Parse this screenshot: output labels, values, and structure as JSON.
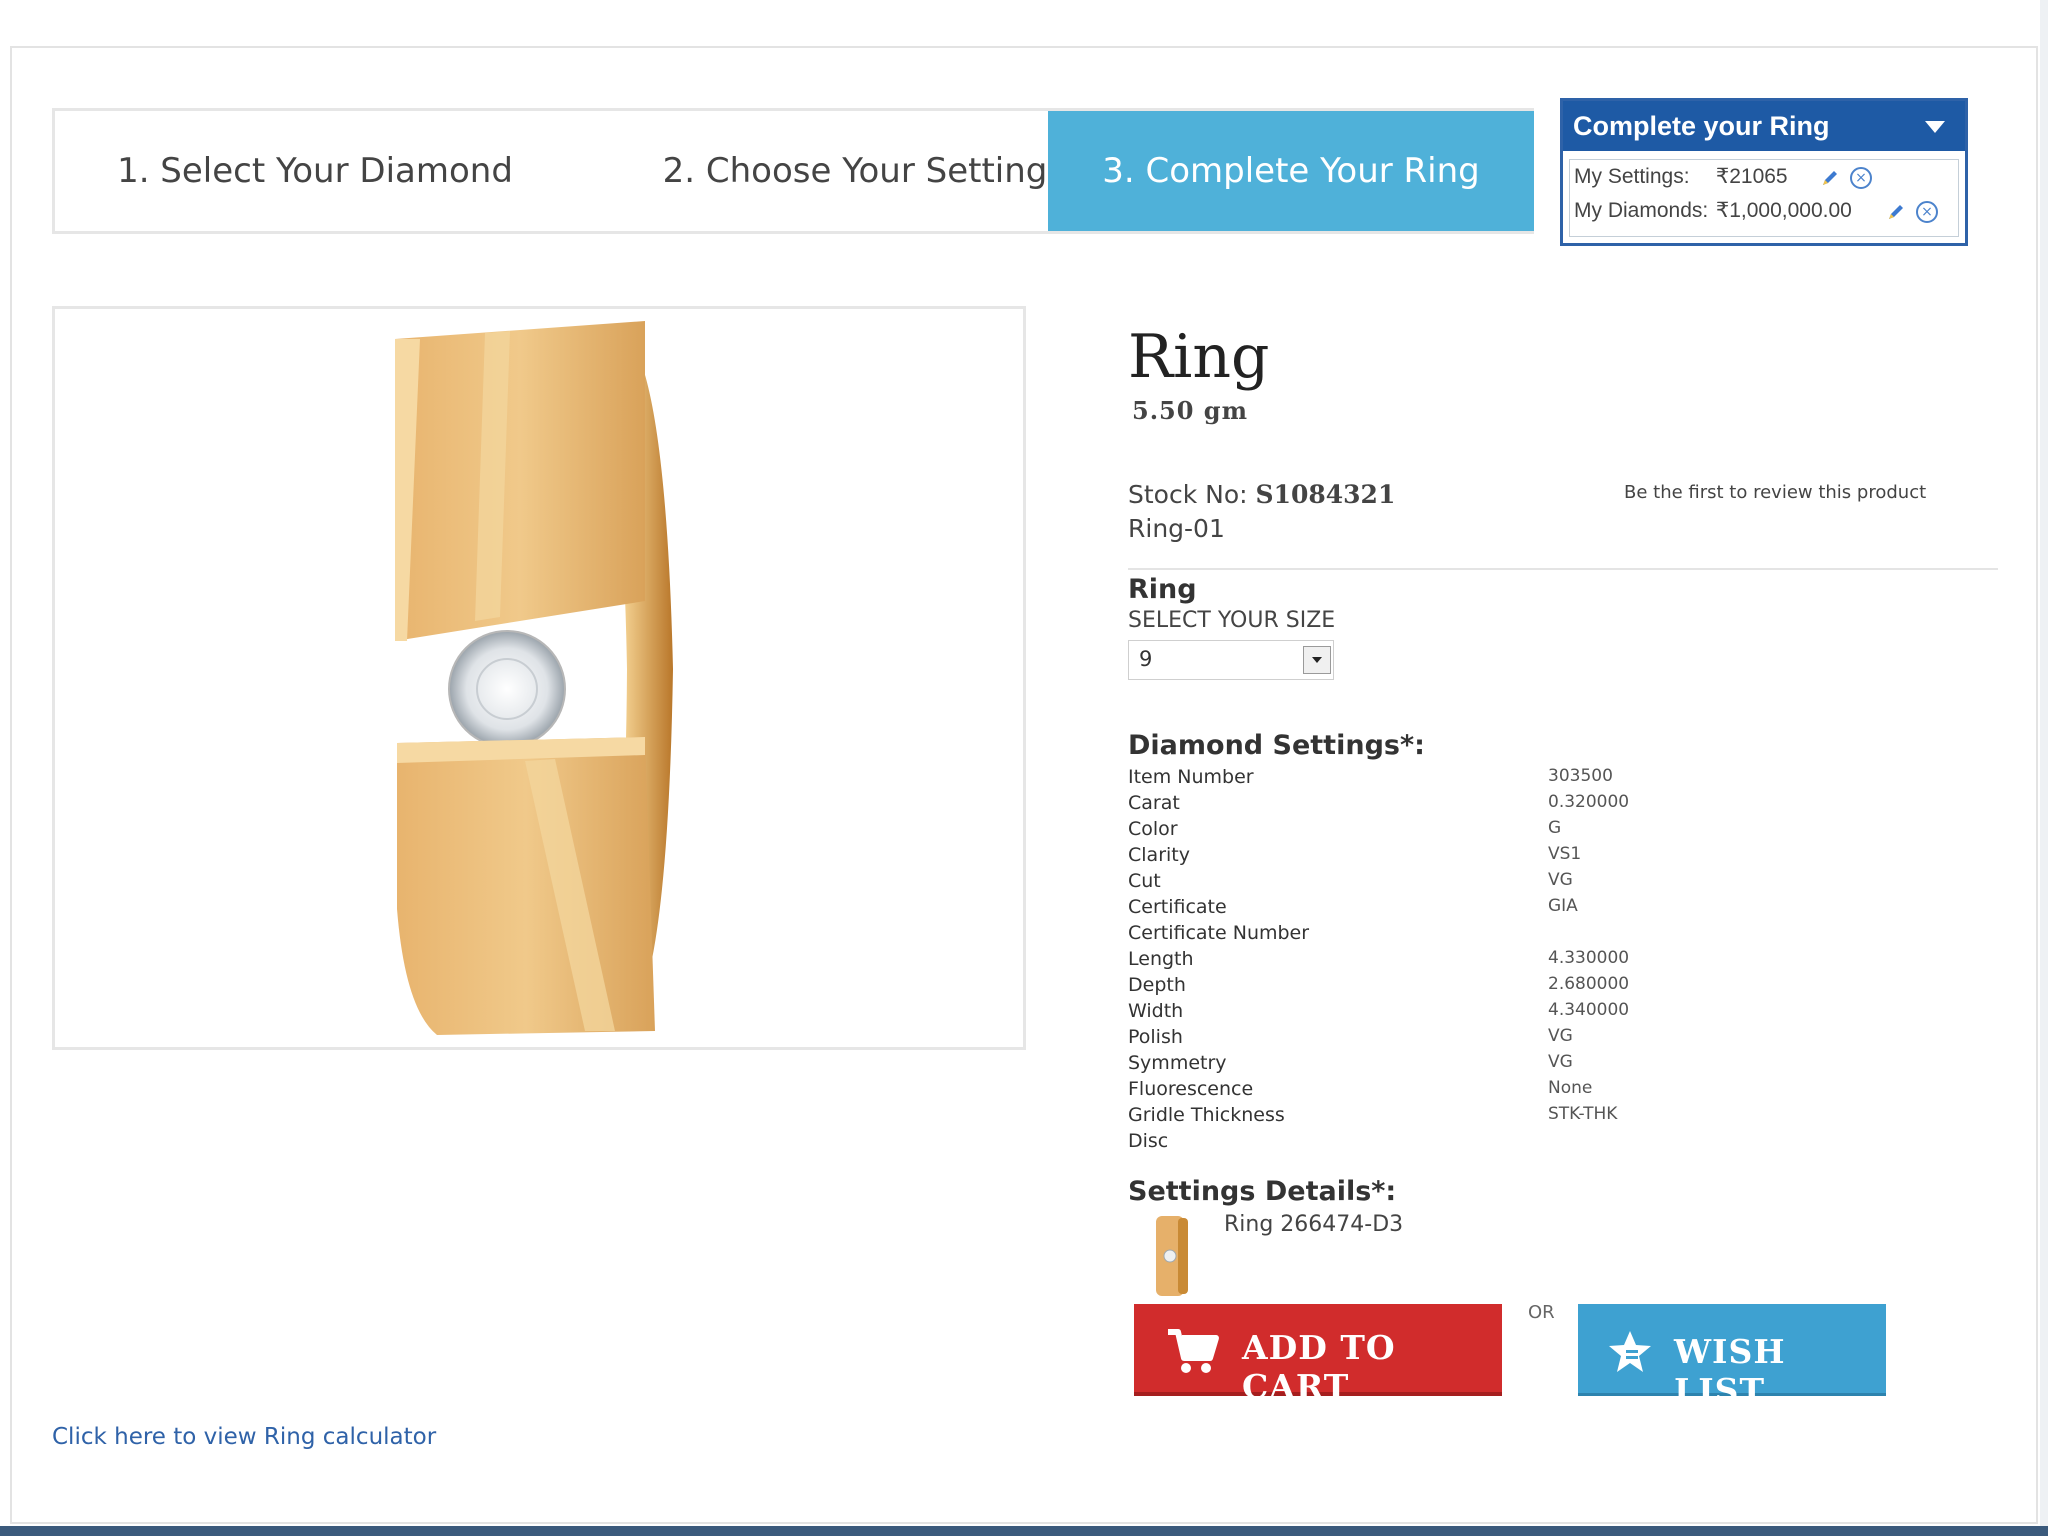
{
  "steps": [
    {
      "label": "1. Select Your Diamond"
    },
    {
      "label": "2. Choose Your Setting"
    },
    {
      "label": "3. Complete Your Ring"
    }
  ],
  "complete_ring": {
    "title": "Complete your Ring",
    "settings_label": "My Settings:",
    "settings_value": "₹21065",
    "diamonds_label": "My Diamonds:",
    "diamonds_value": "₹1,000,000.00"
  },
  "product": {
    "title": "Ring",
    "weight": "5.50 gm",
    "stock_label": "Stock No:",
    "stock_value": "S1084321",
    "model": "Ring-01",
    "review_link": "Be the first to review this product"
  },
  "size": {
    "heading": "Ring",
    "label": "SELECT YOUR SIZE",
    "selected": "9"
  },
  "diamond_settings": {
    "heading": "Diamond Settings*:",
    "rows": [
      {
        "label": "Item Number",
        "value": "303500"
      },
      {
        "label": "Carat",
        "value": "0.320000"
      },
      {
        "label": "Color",
        "value": "G"
      },
      {
        "label": "Clarity",
        "value": "VS1"
      },
      {
        "label": "Cut",
        "value": "VG"
      },
      {
        "label": "Certificate",
        "value": "GIA"
      },
      {
        "label": "Certificate Number",
        "value": ""
      },
      {
        "label": "Length",
        "value": "4.330000"
      },
      {
        "label": "Depth",
        "value": "2.680000"
      },
      {
        "label": "Width",
        "value": "4.340000"
      },
      {
        "label": "Polish",
        "value": "VG"
      },
      {
        "label": "Symmetry",
        "value": "VG"
      },
      {
        "label": "Fluorescence",
        "value": "None"
      },
      {
        "label": "Gridle Thickness",
        "value": "STK-THK"
      },
      {
        "label": "Disc",
        "value": ""
      }
    ]
  },
  "settings_details": {
    "heading": "Settings Details*:",
    "item": "Ring 266474-D3"
  },
  "actions": {
    "add_to_cart": "ADD TO CART",
    "or": "OR",
    "wish_list": "WISH LIST"
  },
  "calculator_link": "Click here to view Ring calculator",
  "colors": {
    "step_active": "#4fb1d9",
    "panel_header": "#1e5aa5",
    "cart_button": "#d12c2c",
    "wish_button": "#3ea1d1",
    "link": "#2f62a8"
  },
  "icons": [
    "pencil-icon",
    "remove-icon",
    "chevron-down-icon",
    "cart-icon",
    "star-icon"
  ]
}
